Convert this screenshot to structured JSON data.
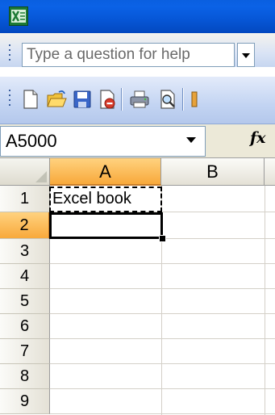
{
  "help": {
    "placeholder": "Type a question for help"
  },
  "toolbar": {
    "icons": [
      "new-document-icon",
      "open-folder-icon",
      "save-icon",
      "permission-icon",
      "print-icon",
      "print-preview-icon"
    ]
  },
  "formula_bar": {
    "name_box": "A5000",
    "fx_label": "fx"
  },
  "sheet": {
    "columns": [
      "A",
      "B"
    ],
    "rows": [
      "1",
      "2",
      "3",
      "4",
      "5",
      "6",
      "7",
      "8",
      "9"
    ],
    "active_column": "A",
    "active_row": "2",
    "cells": {
      "A1": "Excel book"
    }
  },
  "colors": {
    "title_bar": "#0a5fe0",
    "header_highlight": "#f8a93b",
    "excel_green": "#1d7a35"
  }
}
